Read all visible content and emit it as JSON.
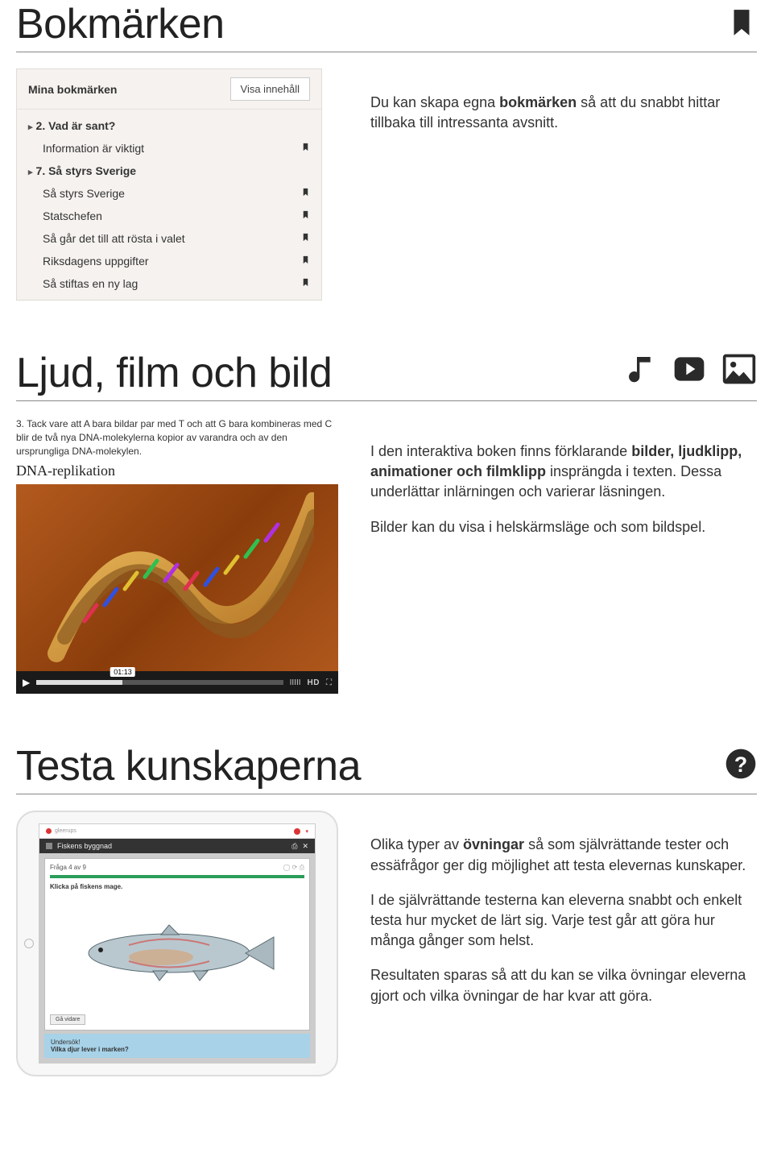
{
  "sections": {
    "bookmarks": {
      "title": "Bokmärken",
      "panel": {
        "header": "Mina bokmärken",
        "button": "Visa innehåll",
        "groups": [
          {
            "label": "2. Vad är sant?",
            "items": [
              "Information är viktigt"
            ]
          },
          {
            "label": "7. Så styrs Sverige",
            "items": [
              "Så styrs Sverige",
              "Statschefen",
              "Så går det till att rösta i valet",
              "Riksdagens uppgifter",
              "Så stiftas en ny lag"
            ]
          }
        ]
      },
      "body_pre": "Du kan skapa egna ",
      "body_bold": "bokmärken",
      "body_post": " så att du snabbt hittar tillbaka till intressanta avsnitt."
    },
    "media": {
      "title": "Ljud, film och bild",
      "caption_num": "3.",
      "caption": "Tack vare att A bara bildar par med T och att G bara kombineras med C blir de två nya DNA-molekylerna kopior av varandra och av den ursprungliga DNA-molekylen.",
      "dna_label": "DNA-replikation",
      "video": {
        "time": "01:13",
        "hd": "HD"
      },
      "p1_pre": "I den interaktiva boken finns förklarande ",
      "p1_b1": "bilder, ljudklipp, animationer och filmklipp",
      "p1_post": " insprängda i texten. Dessa underlättar inlärningen och varierar läsningen.",
      "p2": "Bilder kan du visa i helskärmsläge och som bildspel."
    },
    "test": {
      "title": "Testa kunskaperna",
      "tablet": {
        "bar_title": "Fiskens byggnad",
        "card_sub": "Fråga 4 av 9",
        "instr": "Klicka på fiskens mage.",
        "btn": "Gå vidare",
        "note_t1": "Undersök!",
        "note_t2": "Vilka djur lever i marken?"
      },
      "p1_pre": "Olika typer av ",
      "p1_b": "övningar",
      "p1_post": " så som självrättande tester och essäfrågor ger dig möjlighet att testa elevernas kunskaper.",
      "p2": "I de självrättande testerna kan eleverna snabbt och enkelt testa hur mycket de lärt sig. Varje test går att göra hur många gånger som helst.",
      "p3": "Resultaten sparas så att du kan se vilka övningar eleverna gjort och vilka övningar de har kvar att göra."
    }
  }
}
